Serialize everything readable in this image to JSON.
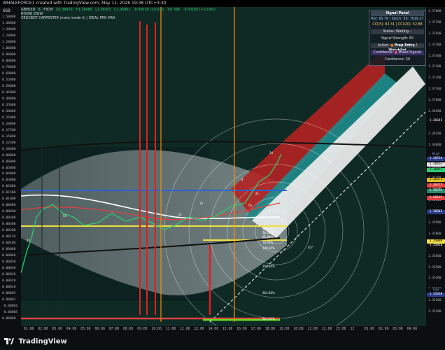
{
  "window": {
    "caption": "WHALEFORCE1 created with TradingView.com, May 11, 2026 19:38 UTC+3:30"
  },
  "legend": {
    "symbol": "GBPUSD · 5 · FXCM",
    "open": "O1.36479",
    "high": "H1.36480",
    "low": "L1.36453",
    "close": "C1.36461",
    "change": "-0.00018 (-0.01%)",
    "volume": "Vol 386",
    "volume_change": "-0.00185 (+0.14%)",
    "indicator1": "RISING ZIGW",
    "indicator2": "CROCBOT CARPENTER (meta inside it) | IDEAL PRO MAX"
  },
  "left_axis": {
    "unit": "USD",
    "ticks": [
      "1.50000",
      "1.40000",
      "1.30000",
      "1.20000",
      "1.10000",
      "1.00000",
      "0.90000",
      "0.80000",
      "0.70000",
      "0.60000",
      "0.55000",
      "0.50000",
      "0.45000",
      "0.40000",
      "0.35000",
      "0.30000",
      "0.25000",
      "0.20000",
      "0.17500",
      "0.15000",
      "0.12500",
      "0.10000",
      "0.08000",
      "0.06000",
      "0.05000",
      "0.04000",
      "0.03000",
      "0.02000",
      "0.01500",
      "0.01000",
      "0.00800",
      "0.00600",
      "0.00400",
      "0.00300",
      "0.00200",
      "0.00150",
      "0.00100",
      "0.00080",
      "0.00060",
      "0.00050",
      "0.00040",
      "0.00030",
      "0.00020",
      "0.00010",
      "0.00005",
      "0.00001",
      "-0.00001",
      "-0.00005",
      "0.00000"
    ]
  },
  "right_axis": {
    "ticks": [
      "1.37800",
      "1.37700",
      "1.37600",
      "1.37500",
      "1.37400",
      "1.37300",
      "1.37200",
      "1.37100",
      "1.37000",
      "1.36900",
      "1.36800",
      "1.36700",
      "1.36600",
      "1.36500",
      "1.36400",
      "1.36300",
      "1.36200",
      "1.36100",
      "1.36000",
      "1.35900",
      "1.35800",
      "1.35700",
      "1.35600",
      "1.35500",
      "1.35400",
      "1.35300",
      "1.35200",
      "1.35100"
    ],
    "tags": [
      {
        "text": "1.36645",
        "bg": "#111111",
        "fg": "#ffffff"
      },
      {
        "text": "High",
        "bg": "#0b0f12",
        "fg": "#9aa4ff"
      },
      {
        "text": "1.36524",
        "bg": "#2a3a8a",
        "fg": "#ffffff"
      },
      {
        "text": "1.36461",
        "bg": "#e6e6e6",
        "fg": "#000000"
      },
      {
        "text": "1.36457",
        "bg": "#2ecc71",
        "fg": "#000000"
      },
      {
        "text": "1.36374",
        "bg": "#e0c020",
        "fg": "#000000"
      },
      {
        "text": "1.36275",
        "bg": "#e04040",
        "fg": "#ffffff"
      },
      {
        "text": "1.36231",
        "bg": "#2a8a6a",
        "fg": "#ffffff"
      },
      {
        "text": "1.36145",
        "bg": "#e04040",
        "fg": "#ffffff"
      },
      {
        "text": "1.36043",
        "bg": "#2a3a8a",
        "fg": "#ffffff"
      },
      {
        "text": "1.35880",
        "bg": "#f0e040",
        "fg": "#000000"
      },
      {
        "text": "1.35818",
        "bg": "#111111",
        "fg": "#ffffff"
      },
      {
        "text": "Low",
        "bg": "#0b0f12",
        "fg": "#9aa4ff"
      },
      {
        "text": "1.35468",
        "bg": "#2a3a8a",
        "fg": "#ffffff"
      }
    ]
  },
  "time_axis": [
    "01:00",
    "02:00",
    "03:00",
    "04:00",
    "05:00",
    "06:00",
    "07:00",
    "08:00",
    "09:00",
    "10:00",
    "11:00",
    "12:00",
    "13:00",
    "14:00",
    "15:00",
    "16:00",
    "17:00",
    "18:00",
    "19:00",
    "20:00",
    "21:00",
    "22:00",
    "23:00",
    "12",
    "01:00",
    "02:00",
    "03:00",
    "04:00"
  ],
  "chart_labels": {
    "fib": [
      "38.20%",
      "50.00%",
      "61.80%",
      "78.60%",
      "100.00%",
      "161.80%",
      "261.80%",
      "361.80%"
    ],
    "angle": "45°",
    "markers": [
      "21",
      "55",
      "21",
      "13",
      "55",
      "8",
      "21",
      "34"
    ]
  },
  "signal_panel": {
    "title": "Signal Panel",
    "rsi": "RSI: 65.79",
    "stoch": "Stoch: 5K: 7019.27",
    "cci": "CCI(5): 82.31",
    "cci20": "CCI(20): 52.88",
    "status": "Status: Waiting...",
    "strength": "Signal Strength: 60",
    "action_label": "Action:",
    "action_value": "Prep Entry / Watchlist",
    "confidence_label": "Confidence:",
    "confidence_value": "Mixed Signals",
    "confidence_score": "Confidence: 50"
  },
  "footer": {
    "brand": "TradingView"
  },
  "colors": {
    "chart_bg": "#0f2a24",
    "bear_channel": "#b22222",
    "bull_channel": "#1e8c8c",
    "bull_candle": "#2ecc71",
    "bear_candle": "#e04040",
    "ma_white": "#ffffff",
    "ma_yellow": "#f0e040",
    "ma_blue": "#2a63d6"
  }
}
